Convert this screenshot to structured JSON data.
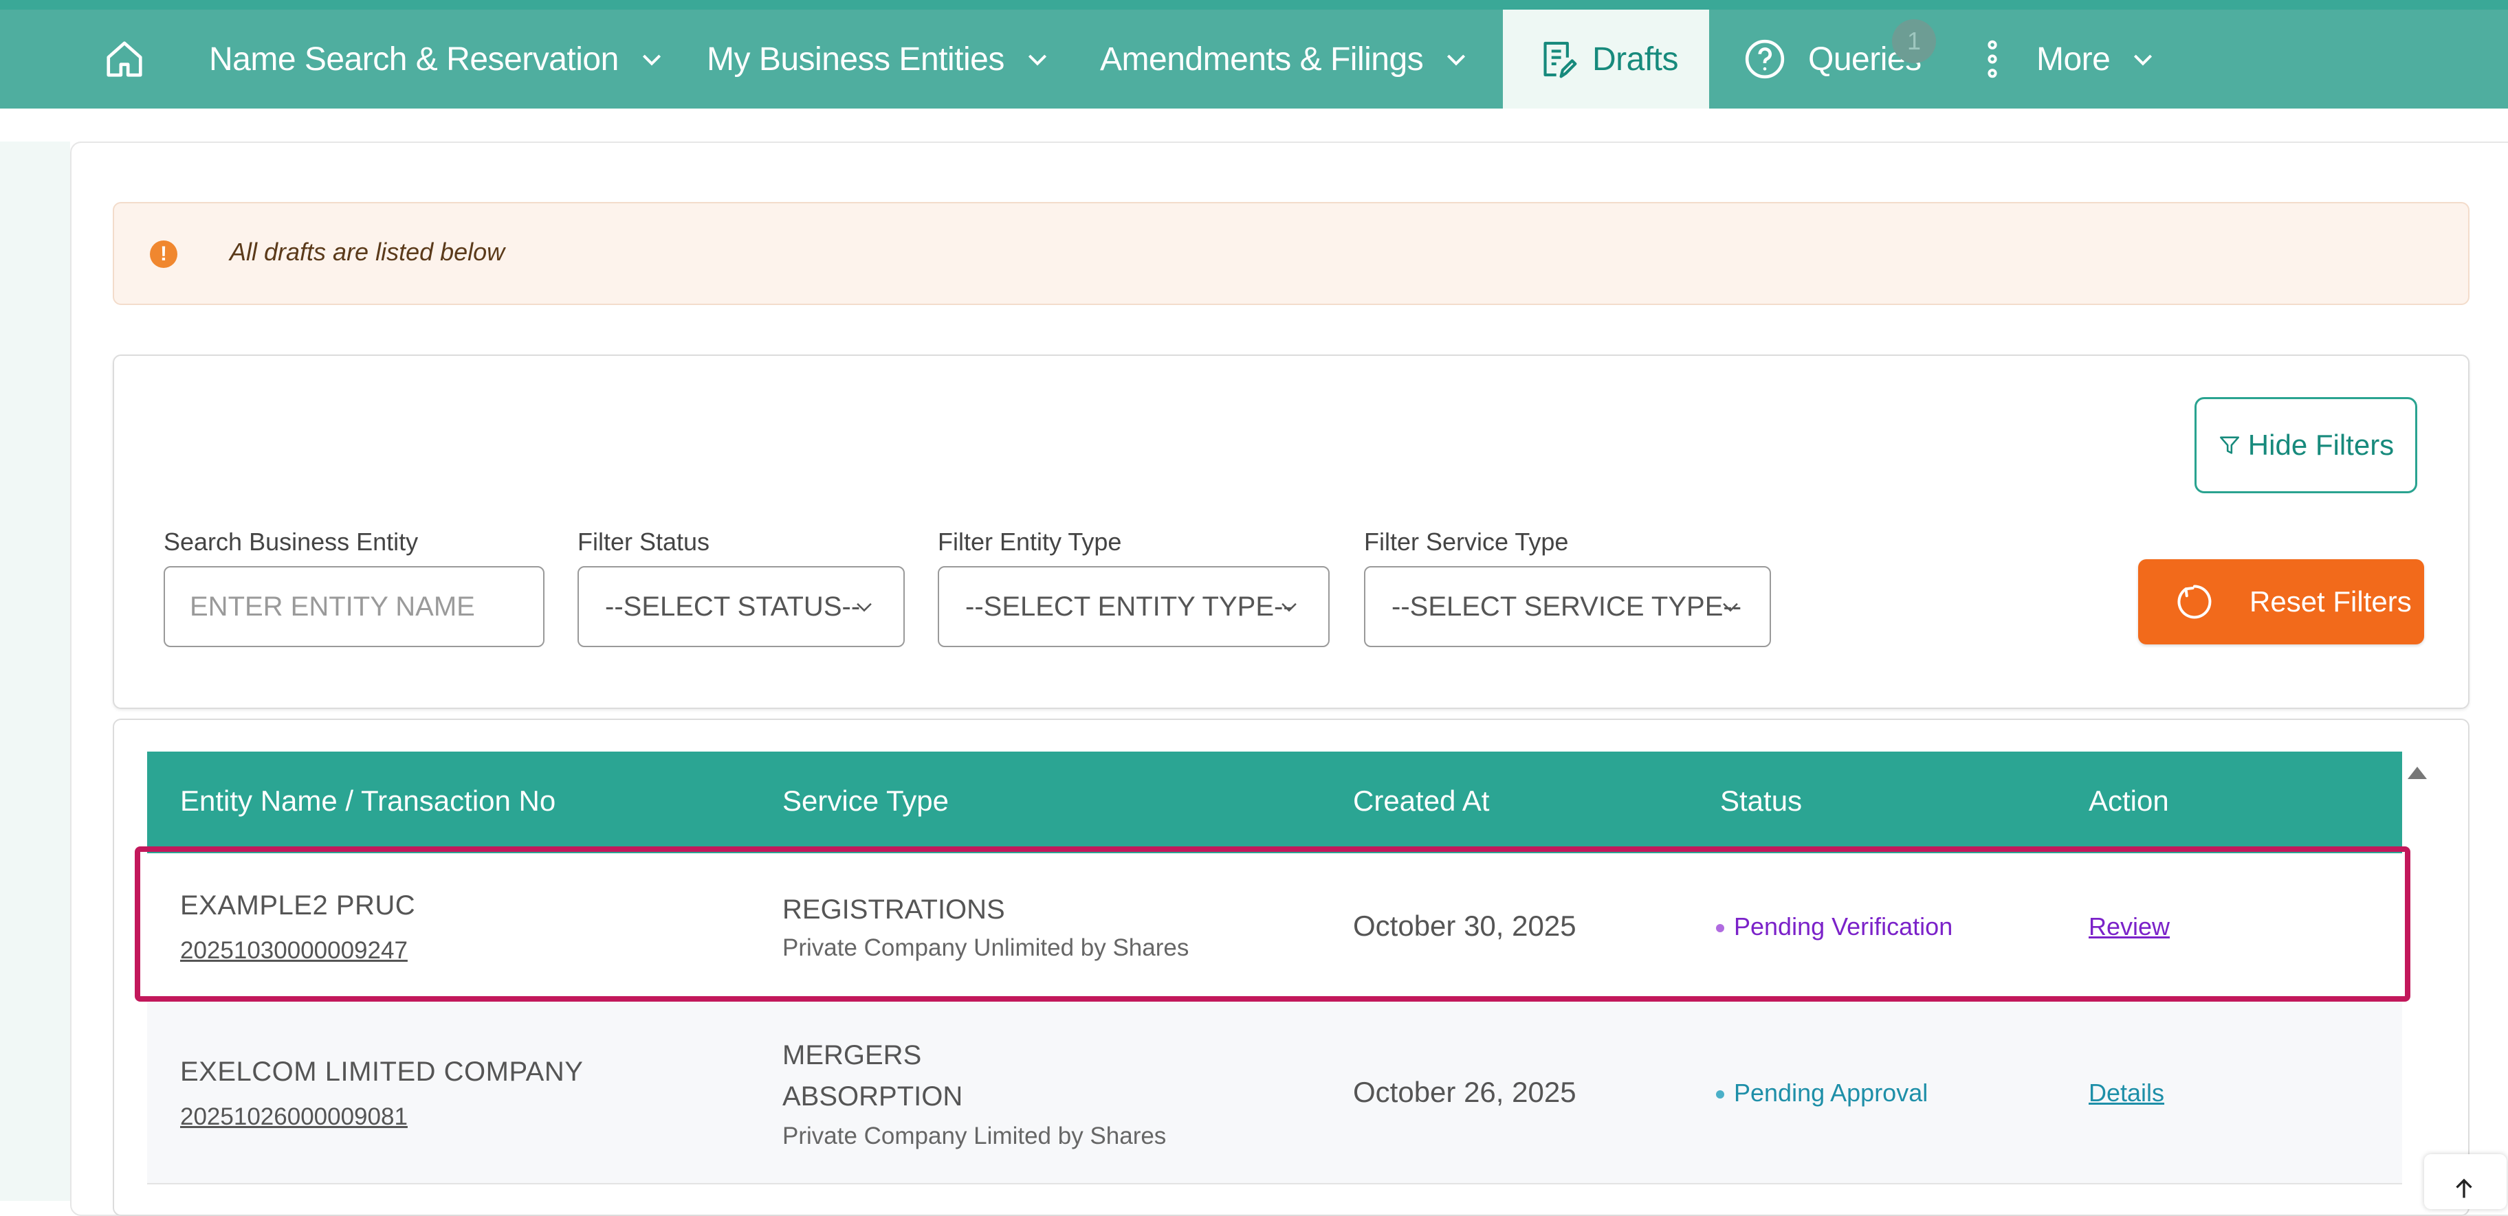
{
  "nav": {
    "home_icon": "home-icon",
    "items": [
      {
        "label": "Name Search & Reservation",
        "has_dropdown": true
      },
      {
        "label": "My Business Entities",
        "has_dropdown": true
      },
      {
        "label": "Amendments & Filings",
        "has_dropdown": true
      },
      {
        "label": "Drafts",
        "icon": "document-edit-icon",
        "active": true
      },
      {
        "label": "Queries",
        "icon": "question-circle-icon",
        "badge": "1"
      },
      {
        "label": "More",
        "icon": "vertical-dots-icon",
        "has_dropdown": true
      }
    ]
  },
  "alert": {
    "icon": "exclamation-circle-icon",
    "text": "All drafts are listed below",
    "color": "#f0872f"
  },
  "filters": {
    "hide_button": "Hide Filters",
    "search": {
      "label": "Search Business Entity",
      "placeholder": "ENTER ENTITY NAME"
    },
    "status": {
      "label": "Filter Status",
      "selected": "--SELECT STATUS--"
    },
    "entity_type": {
      "label": "Filter Entity Type",
      "selected": "--SELECT ENTITY TYPE--"
    },
    "service_type": {
      "label": "Filter Service Type",
      "selected": "--SELECT SERVICE TYPE--"
    },
    "reset_button": "Reset Filters"
  },
  "table": {
    "columns": [
      "Entity Name / Transaction No",
      "Service Type",
      "Created At",
      "Status",
      "Action"
    ],
    "rows": [
      {
        "entity_name": "EXAMPLE2 PRUC",
        "transaction_no": "20251030000009247",
        "service_lines": [
          "REGISTRATIONS"
        ],
        "service_sub": "Private Company Unlimited by Shares",
        "created_at": "October 30, 2025",
        "status": "Pending Verification",
        "status_color": "#7b22c9",
        "action": "Review"
      },
      {
        "entity_name": "EXELCOM LIMITED COMPANY",
        "transaction_no": "20251026000009081",
        "service_lines": [
          "MERGERS",
          "ABSORPTION"
        ],
        "service_sub": "Private Company Limited by Shares",
        "created_at": "October 26, 2025",
        "status": "Pending Approval",
        "status_color": "#1e8fa8",
        "action": "Details"
      }
    ]
  },
  "colors": {
    "nav_bg": "#4fae9f",
    "table_header": "#2ba593",
    "reset_button": "#f26a1b",
    "highlight_border": "#c2185b"
  }
}
